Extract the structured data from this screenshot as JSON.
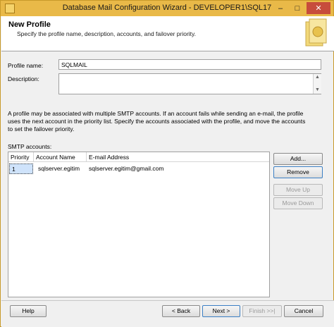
{
  "window": {
    "title": "Database Mail Configuration Wizard - DEVELOPER1\\SQL17",
    "minimize": "–",
    "maximize": "□",
    "close": "✕"
  },
  "header": {
    "title": "New Profile",
    "subtitle": "Specify the profile name, description, accounts, and failover priority."
  },
  "form": {
    "profile_name_label": "Profile name:",
    "profile_name_value": "SQLMAIL",
    "description_label": "Description:",
    "description_value": ""
  },
  "info_text": "A profile may be associated with multiple SMTP accounts. If an account fails while sending an e-mail, the profile uses the next account in the priority list. Specify the accounts associated with the profile, and move the accounts to set the failover priority.",
  "smtp": {
    "label": "SMTP accounts:",
    "columns": [
      "Priority",
      "Account Name",
      "E-mail Address"
    ],
    "rows": [
      {
        "priority": "1",
        "account": "sqlserver.egitim",
        "email": "sqlserver.egitim@gmail.com"
      }
    ]
  },
  "side_buttons": {
    "add": "Add...",
    "remove": "Remove",
    "move_up": "Move Up",
    "move_down": "Move Down"
  },
  "footer": {
    "help": "Help",
    "back": "< Back",
    "next": "Next >",
    "finish": "Finish >>|",
    "cancel": "Cancel"
  },
  "scroll": {
    "up": "▲",
    "down": "▼"
  }
}
